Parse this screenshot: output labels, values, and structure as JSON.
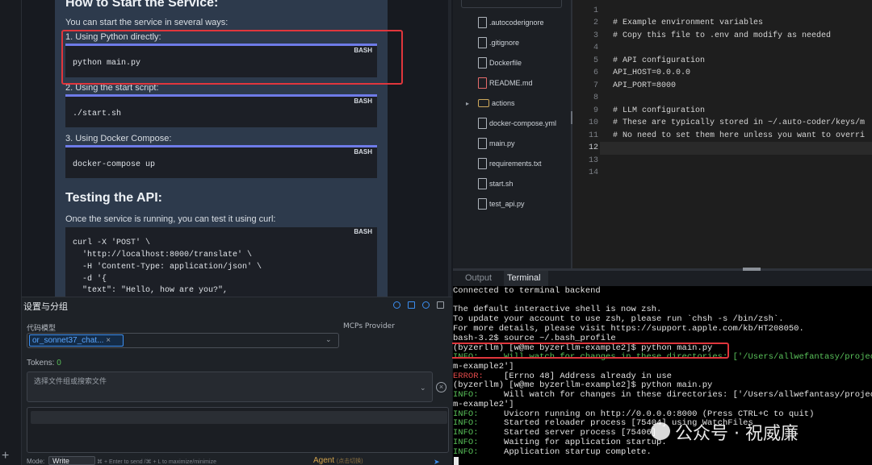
{
  "preview": {
    "heading_start": "How to Start the Service:",
    "intro": "You can start the service in several ways:",
    "step1": "1. Using Python directly:",
    "code1": "python main.py",
    "step2": "2. Using the start script:",
    "code2": "./start.sh",
    "step3": "3. Using Docker Compose:",
    "code3": "docker-compose up",
    "heading_test": "Testing the API:",
    "test_intro": "Once the service is running, you can test it using curl:",
    "curl_lines": [
      "curl -X 'POST' \\",
      "  'http://localhost:8000/translate' \\",
      "  -H 'Content-Type: application/json' \\",
      "  -d '{",
      "  \"text\": \"Hello, how are you?\","
    ],
    "code_lang": "BASH"
  },
  "file_tree": {
    "items": [
      {
        "name": ".autocoderignore",
        "kind": "file"
      },
      {
        "name": ".gitignore",
        "kind": "file"
      },
      {
        "name": "Dockerfile",
        "kind": "file"
      },
      {
        "name": "README.md",
        "kind": "markdown"
      },
      {
        "name": "actions",
        "kind": "folder"
      },
      {
        "name": "docker-compose.yml",
        "kind": "file"
      },
      {
        "name": "main.py",
        "kind": "file"
      },
      {
        "name": "requirements.txt",
        "kind": "file"
      },
      {
        "name": "start.sh",
        "kind": "file"
      },
      {
        "name": "test_api.py",
        "kind": "file"
      }
    ]
  },
  "editor": {
    "line_numbers": [
      "1",
      "2",
      "3",
      "4",
      "5",
      "6",
      "7",
      "8",
      "9",
      "10",
      "11",
      "12",
      "13",
      "14"
    ],
    "lines": [
      "",
      "",
      "# Example environment variables",
      "# Copy this file to .env and modify as needed",
      "",
      "# API configuration",
      "API_HOST=0.0.0.0",
      "API_PORT=8000",
      "",
      "# LLM configuration",
      "# These are typically stored in ~/.auto-coder/keys/m",
      "# No need to set them here unless you want to overri",
      "",
      ""
    ]
  },
  "terminal": {
    "tab_output": "Output",
    "tab_terminal": "Terminal",
    "lines": [
      "Connected to terminal backend",
      "",
      "The default interactive shell is now zsh.",
      "To update your account to use zsh, please run `chsh -s /bin/zsh`.",
      "For more details, please visit https://support.apple.com/kb/HT208050.",
      "bash-3.2$ source ~/.bash_profile",
      "(byzerllm) [w@me byzerllm-example2]$ python main.py",
      "INFO:     Will watch for changes in these directories: ['/Users/allwefantasy/project",
      "m-example2']",
      "ERROR:    [Errno 48] Address already in use",
      "(byzerllm) [w@me byzerllm-example2]$ python main.py",
      "INFO:     Will watch for changes in these directories: ['/Users/allwefantasy/project",
      "m-example2']",
      "INFO:     Uvicorn running on http://0.0.0.0:8000 (Press CTRL+C to quit)",
      "INFO:     Started reloader process [75404] using WatchFiles",
      "INFO:     Started server process [75406]",
      "INFO:     Waiting for application startup.",
      "INFO:     Application startup complete."
    ],
    "watermark": "公众号 · 祝威廉"
  },
  "settings": {
    "title": "设置与分组",
    "model_label": "代码模型",
    "mcp_label": "MCPs Provider",
    "model_value": "or_sonnet37_chat...",
    "model_remove": "×",
    "tokens_label": "Tokens:",
    "tokens_value": "0",
    "file_placeholder": "选择文件组或搜索文件",
    "mode_label": "Mode:",
    "mode_value": "Write",
    "shortcut_hint": "⌘ + Enter to send /⌘ + L to maximize/minimize",
    "agent_label": "Agent",
    "agent_hint": "(点击切换)"
  },
  "gutter": {
    "add": "+"
  }
}
